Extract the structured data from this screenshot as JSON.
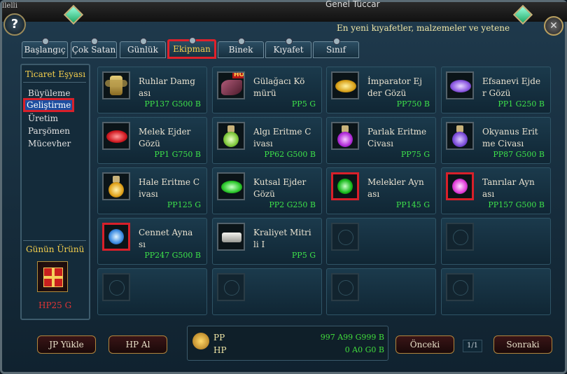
{
  "window": {
    "corner_text": "llelli",
    "title": "Genel Tüccar",
    "help_label": "?",
    "close_label": "✕",
    "ticker": "En yeni kıyafetler, malzemeler ve yetene"
  },
  "tabs": [
    {
      "label": "Başlangıç"
    },
    {
      "label": "Çok Satan"
    },
    {
      "label": "Günlük"
    },
    {
      "label": "Ekipman",
      "active": true
    },
    {
      "label": "Binek"
    },
    {
      "label": "Kıyafet"
    },
    {
      "label": "Sınıf"
    }
  ],
  "sidebar": {
    "title": "Ticaret Eşyası",
    "items": [
      {
        "label": "Büyüleme"
      },
      {
        "label": "Geliştirme",
        "active": true
      },
      {
        "label": "Üretim"
      },
      {
        "label": "Parşömen"
      },
      {
        "label": "Mücevher"
      }
    ],
    "daily": {
      "title": "Günün Ürünü",
      "price": "HP25 G",
      "icon": "gift-box-icon"
    }
  },
  "items": [
    {
      "name": "Ruhlar Damg ası",
      "price": "PP137 G500 B",
      "icon": "winged-emblem-icon"
    },
    {
      "name": "Gülağacı Kö mürü",
      "price": "PP5 G",
      "icon": "charcoal-icon",
      "hot": "HOT"
    },
    {
      "name": "İmparator Ej der Gözü",
      "price": "PP750 B",
      "icon": "gold-gem-icon"
    },
    {
      "name": "Efsanevi Ejde r Gözü",
      "price": "PP1 G250 B",
      "icon": "purple-gem-icon"
    },
    {
      "name": "Melek Ejder Gözü",
      "price": "PP1 G750 B",
      "icon": "red-gem-icon"
    },
    {
      "name": "Algı Eritme C ivası",
      "price": "PP62 G500 B",
      "icon": "green-potion-icon"
    },
    {
      "name": "Parlak Eritme Civası",
      "price": "PP75 G",
      "icon": "purple-potion-icon"
    },
    {
      "name": "Okyanus Erit me Civası",
      "price": "PP87 G500 B",
      "icon": "violet-potion-icon"
    },
    {
      "name": "Hale Eritme C ivası",
      "price": "PP125 G",
      "icon": "amber-potion-icon"
    },
    {
      "name": "Kutsal Ejder Gözü",
      "price": "PP2 G250 B",
      "icon": "green-gem-icon"
    },
    {
      "name": "Melekler Ayn ası",
      "price": "PP145 G",
      "icon": "green-orb-icon",
      "selected": true
    },
    {
      "name": "Tanrılar Ayn ası",
      "price": "PP157 G500 B",
      "icon": "pink-orb-icon",
      "selected": true
    },
    {
      "name": "Cennet Ayna sı",
      "price": "PP247 G500 B",
      "icon": "blue-orb-icon",
      "selected": true
    },
    {
      "name": "Kraliyet Mitri li I",
      "price": "PP5 G",
      "icon": "silver-ingot-icon"
    }
  ],
  "footer": {
    "jp_button": "JP Yükle",
    "hp_button": "HP Al",
    "pp_label": "PP",
    "hp_label": "HP",
    "pp_value": "997 A99 G999 B",
    "hp_value": "0 A0 G0 B",
    "prev_button": "Önceki",
    "next_button": "Sonraki",
    "page_indicator": "1/1"
  },
  "colors": {
    "price_green": "#3ee34a",
    "highlight_red": "#d8202a",
    "title_gold": "#f6d04d"
  }
}
